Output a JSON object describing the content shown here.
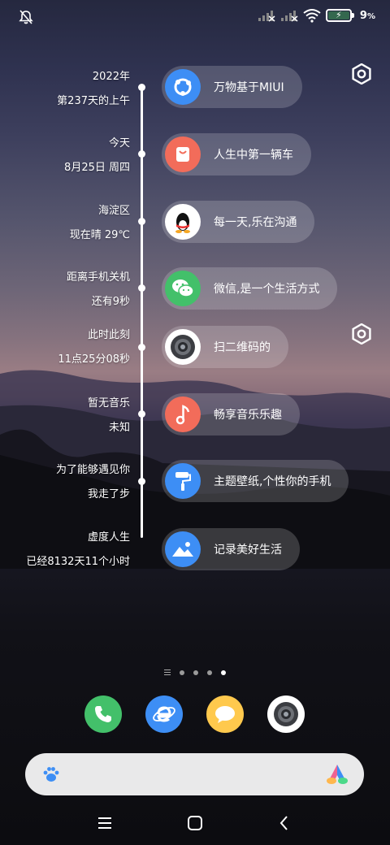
{
  "statusbar": {
    "battery_percent": "9",
    "battery_unit": "%",
    "icons": [
      "bell-off-icon",
      "signal-1-icon",
      "signal-2-icon",
      "wifi-icon",
      "battery-charging-icon"
    ]
  },
  "timeline": [
    {
      "line1": "2022年",
      "line2": "第237天的上午",
      "app": "万物基于MIUI",
      "icon": "miui-icon",
      "color": "#3d8ef5"
    },
    {
      "line1": "今天",
      "line2": "8月25日 周四",
      "app": "人生中第一辆车",
      "icon": "shopping-bag-icon",
      "color": "#f26c5a"
    },
    {
      "line1": "海淀区",
      "line2": "现在晴 29℃",
      "app": "每一天,乐在沟通",
      "icon": "qq-penguin-icon",
      "color": "#ffffff"
    },
    {
      "line1": "距离手机关机",
      "line2": "还有9秒",
      "app": "微信,是一个生活方式",
      "icon": "wechat-icon",
      "color": "#43c06a"
    },
    {
      "line1": "此时此刻",
      "line2": "11点25分08秒",
      "app": "扫二维码的",
      "icon": "camera-lens-icon",
      "color": "#ffffff"
    },
    {
      "line1": "暂无音乐",
      "line2": "未知",
      "app": "畅享音乐乐趣",
      "icon": "music-note-icon",
      "color": "#f26c5a"
    },
    {
      "line1": "为了能够遇见你",
      "line2": "我走了步",
      "app": "主题壁纸,个性你的手机",
      "icon": "paint-roller-icon",
      "color": "#3d8ef5"
    },
    {
      "line1": "虚度人生",
      "line2": "已经8132天11个小时",
      "app": "记录美好生活",
      "icon": "gallery-icon",
      "color": "#3d8ef5"
    }
  ],
  "pager": {
    "pages": 4,
    "active": 4
  },
  "dock": [
    {
      "name": "phone",
      "icon": "phone-icon",
      "color": "#43c06a"
    },
    {
      "name": "browser",
      "icon": "browser-icon",
      "color": "#3d8ef5"
    },
    {
      "name": "messages",
      "icon": "message-icon",
      "color": "#ffc94d"
    },
    {
      "name": "camera",
      "icon": "camera-lens-icon",
      "color": "#ffffff"
    }
  ],
  "search": {
    "left_icon": "paw-icon",
    "right_icon": "assistant-logo-icon"
  },
  "navbar": {
    "icons": [
      "menu-icon",
      "home-icon",
      "back-icon"
    ]
  }
}
